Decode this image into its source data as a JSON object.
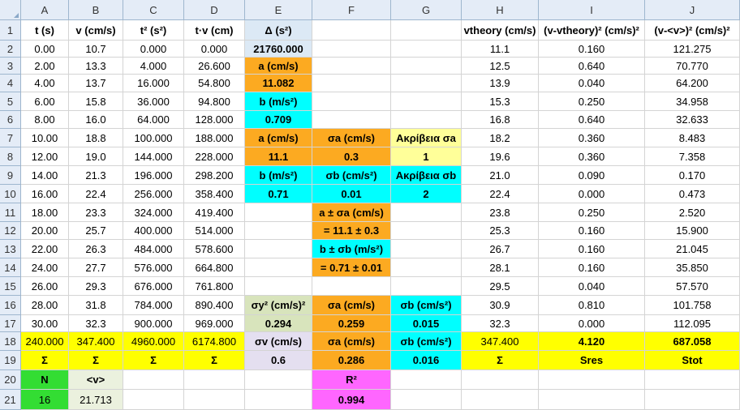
{
  "columns": [
    "A",
    "B",
    "C",
    "D",
    "E",
    "F",
    "G",
    "H",
    "I",
    "J"
  ],
  "rows": [
    "1",
    "2",
    "3",
    "4",
    "5",
    "6",
    "7",
    "8",
    "9",
    "10",
    "11",
    "12",
    "13",
    "14",
    "15",
    "16",
    "17",
    "18",
    "19",
    "20",
    "21"
  ],
  "colors": {
    "orange": "#fcaa21",
    "cyan": "#00ffff",
    "lightyellow": "#ffff99",
    "yellow": "#ffff00",
    "lightblue": "#dce9f5",
    "lightgreen": "#d8e4bc",
    "green": "#33dd33",
    "lavender": "#e4dff0",
    "magenta": "#ff66ff",
    "greenbg": "#ebf1de"
  },
  "cells": [
    {
      "r": 1,
      "c": "A",
      "t": "t (s)",
      "b": true
    },
    {
      "r": 1,
      "c": "B",
      "t": "v (cm/s)",
      "b": true
    },
    {
      "r": 1,
      "c": "C",
      "t": "t² (s²)",
      "b": true
    },
    {
      "r": 1,
      "c": "D",
      "t": "t·v (cm)",
      "b": true
    },
    {
      "r": 1,
      "c": "E",
      "t": "Δ (s²)",
      "b": true,
      "bg": "lightblue"
    },
    {
      "r": 1,
      "c": "H",
      "t": "vtheory (cm/s)",
      "b": true
    },
    {
      "r": 1,
      "c": "I",
      "t": "(v-vtheory)² (cm/s)²",
      "b": true
    },
    {
      "r": 1,
      "c": "J",
      "t": "(v-<v>)² (cm/s)²",
      "b": true
    },
    {
      "r": 2,
      "c": "A",
      "t": "0.00"
    },
    {
      "r": 2,
      "c": "B",
      "t": "10.7"
    },
    {
      "r": 2,
      "c": "C",
      "t": "0.000"
    },
    {
      "r": 2,
      "c": "D",
      "t": "0.000"
    },
    {
      "r": 2,
      "c": "E",
      "t": "21760.000",
      "b": true,
      "bg": "lightblue"
    },
    {
      "r": 2,
      "c": "H",
      "t": "11.1"
    },
    {
      "r": 2,
      "c": "I",
      "t": "0.160"
    },
    {
      "r": 2,
      "c": "J",
      "t": "121.275"
    },
    {
      "r": 3,
      "c": "A",
      "t": "2.00"
    },
    {
      "r": 3,
      "c": "B",
      "t": "13.3"
    },
    {
      "r": 3,
      "c": "C",
      "t": "4.000"
    },
    {
      "r": 3,
      "c": "D",
      "t": "26.600"
    },
    {
      "r": 3,
      "c": "E",
      "t": "a (cm/s)",
      "b": true,
      "bg": "orange"
    },
    {
      "r": 3,
      "c": "H",
      "t": "12.5"
    },
    {
      "r": 3,
      "c": "I",
      "t": "0.640"
    },
    {
      "r": 3,
      "c": "J",
      "t": "70.770"
    },
    {
      "r": 4,
      "c": "A",
      "t": "4.00"
    },
    {
      "r": 4,
      "c": "B",
      "t": "13.7"
    },
    {
      "r": 4,
      "c": "C",
      "t": "16.000"
    },
    {
      "r": 4,
      "c": "D",
      "t": "54.800"
    },
    {
      "r": 4,
      "c": "E",
      "t": "11.082",
      "b": true,
      "bg": "orange"
    },
    {
      "r": 4,
      "c": "H",
      "t": "13.9"
    },
    {
      "r": 4,
      "c": "I",
      "t": "0.040"
    },
    {
      "r": 4,
      "c": "J",
      "t": "64.200"
    },
    {
      "r": 5,
      "c": "A",
      "t": "6.00"
    },
    {
      "r": 5,
      "c": "B",
      "t": "15.8"
    },
    {
      "r": 5,
      "c": "C",
      "t": "36.000"
    },
    {
      "r": 5,
      "c": "D",
      "t": "94.800"
    },
    {
      "r": 5,
      "c": "E",
      "t": "b (m/s²)",
      "b": true,
      "bg": "cyan"
    },
    {
      "r": 5,
      "c": "H",
      "t": "15.3"
    },
    {
      "r": 5,
      "c": "I",
      "t": "0.250"
    },
    {
      "r": 5,
      "c": "J",
      "t": "34.958"
    },
    {
      "r": 6,
      "c": "A",
      "t": "8.00"
    },
    {
      "r": 6,
      "c": "B",
      "t": "16.0"
    },
    {
      "r": 6,
      "c": "C",
      "t": "64.000"
    },
    {
      "r": 6,
      "c": "D",
      "t": "128.000"
    },
    {
      "r": 6,
      "c": "E",
      "t": "0.709",
      "b": true,
      "bg": "cyan"
    },
    {
      "r": 6,
      "c": "H",
      "t": "16.8"
    },
    {
      "r": 6,
      "c": "I",
      "t": "0.640"
    },
    {
      "r": 6,
      "c": "J",
      "t": "32.633"
    },
    {
      "r": 7,
      "c": "A",
      "t": "10.00"
    },
    {
      "r": 7,
      "c": "B",
      "t": "18.8"
    },
    {
      "r": 7,
      "c": "C",
      "t": "100.000"
    },
    {
      "r": 7,
      "c": "D",
      "t": "188.000"
    },
    {
      "r": 7,
      "c": "E",
      "t": "a (cm/s)",
      "b": true,
      "bg": "orange"
    },
    {
      "r": 7,
      "c": "F",
      "t": "σa (cm/s)",
      "b": true,
      "bg": "orange"
    },
    {
      "r": 7,
      "c": "G",
      "t": "Ακρίβεια σa",
      "b": true,
      "bg": "lightyellow"
    },
    {
      "r": 7,
      "c": "H",
      "t": "18.2"
    },
    {
      "r": 7,
      "c": "I",
      "t": "0.360"
    },
    {
      "r": 7,
      "c": "J",
      "t": "8.483"
    },
    {
      "r": 8,
      "c": "A",
      "t": "12.00"
    },
    {
      "r": 8,
      "c": "B",
      "t": "19.0"
    },
    {
      "r": 8,
      "c": "C",
      "t": "144.000"
    },
    {
      "r": 8,
      "c": "D",
      "t": "228.000"
    },
    {
      "r": 8,
      "c": "E",
      "t": "11.1",
      "b": true,
      "bg": "orange"
    },
    {
      "r": 8,
      "c": "F",
      "t": "0.3",
      "b": true,
      "bg": "orange"
    },
    {
      "r": 8,
      "c": "G",
      "t": "1",
      "b": true,
      "bg": "lightyellow"
    },
    {
      "r": 8,
      "c": "H",
      "t": "19.6"
    },
    {
      "r": 8,
      "c": "I",
      "t": "0.360"
    },
    {
      "r": 8,
      "c": "J",
      "t": "7.358"
    },
    {
      "r": 9,
      "c": "A",
      "t": "14.00"
    },
    {
      "r": 9,
      "c": "B",
      "t": "21.3"
    },
    {
      "r": 9,
      "c": "C",
      "t": "196.000"
    },
    {
      "r": 9,
      "c": "D",
      "t": "298.200"
    },
    {
      "r": 9,
      "c": "E",
      "t": "b (m/s²)",
      "b": true,
      "bg": "cyan"
    },
    {
      "r": 9,
      "c": "F",
      "t": "σb (cm/s²)",
      "b": true,
      "bg": "cyan"
    },
    {
      "r": 9,
      "c": "G",
      "t": "Ακρίβεια σb",
      "b": true,
      "bg": "cyan"
    },
    {
      "r": 9,
      "c": "H",
      "t": "21.0"
    },
    {
      "r": 9,
      "c": "I",
      "t": "0.090"
    },
    {
      "r": 9,
      "c": "J",
      "t": "0.170"
    },
    {
      "r": 10,
      "c": "A",
      "t": "16.00"
    },
    {
      "r": 10,
      "c": "B",
      "t": "22.4"
    },
    {
      "r": 10,
      "c": "C",
      "t": "256.000"
    },
    {
      "r": 10,
      "c": "D",
      "t": "358.400"
    },
    {
      "r": 10,
      "c": "E",
      "t": "0.71",
      "b": true,
      "bg": "cyan"
    },
    {
      "r": 10,
      "c": "F",
      "t": "0.01",
      "b": true,
      "bg": "cyan"
    },
    {
      "r": 10,
      "c": "G",
      "t": "2",
      "b": true,
      "bg": "cyan"
    },
    {
      "r": 10,
      "c": "H",
      "t": "22.4"
    },
    {
      "r": 10,
      "c": "I",
      "t": "0.000"
    },
    {
      "r": 10,
      "c": "J",
      "t": "0.473"
    },
    {
      "r": 11,
      "c": "A",
      "t": "18.00"
    },
    {
      "r": 11,
      "c": "B",
      "t": "23.3"
    },
    {
      "r": 11,
      "c": "C",
      "t": "324.000"
    },
    {
      "r": 11,
      "c": "D",
      "t": "419.400"
    },
    {
      "r": 11,
      "c": "F",
      "t": "a ± σa (cm/s)",
      "b": true,
      "bg": "orange"
    },
    {
      "r": 11,
      "c": "H",
      "t": "23.8"
    },
    {
      "r": 11,
      "c": "I",
      "t": "0.250"
    },
    {
      "r": 11,
      "c": "J",
      "t": "2.520"
    },
    {
      "r": 12,
      "c": "A",
      "t": "20.00"
    },
    {
      "r": 12,
      "c": "B",
      "t": "25.7"
    },
    {
      "r": 12,
      "c": "C",
      "t": "400.000"
    },
    {
      "r": 12,
      "c": "D",
      "t": "514.000"
    },
    {
      "r": 12,
      "c": "F",
      "t": "= 11.1 ± 0.3",
      "b": true,
      "bg": "orange"
    },
    {
      "r": 12,
      "c": "H",
      "t": "25.3"
    },
    {
      "r": 12,
      "c": "I",
      "t": "0.160"
    },
    {
      "r": 12,
      "c": "J",
      "t": "15.900"
    },
    {
      "r": 13,
      "c": "A",
      "t": "22.00"
    },
    {
      "r": 13,
      "c": "B",
      "t": "26.3"
    },
    {
      "r": 13,
      "c": "C",
      "t": "484.000"
    },
    {
      "r": 13,
      "c": "D",
      "t": "578.600"
    },
    {
      "r": 13,
      "c": "F",
      "t": "b ± σb (m/s²)",
      "b": true,
      "bg": "cyan"
    },
    {
      "r": 13,
      "c": "H",
      "t": "26.7"
    },
    {
      "r": 13,
      "c": "I",
      "t": "0.160"
    },
    {
      "r": 13,
      "c": "J",
      "t": "21.045"
    },
    {
      "r": 14,
      "c": "A",
      "t": "24.00"
    },
    {
      "r": 14,
      "c": "B",
      "t": "27.7"
    },
    {
      "r": 14,
      "c": "C",
      "t": "576.000"
    },
    {
      "r": 14,
      "c": "D",
      "t": "664.800"
    },
    {
      "r": 14,
      "c": "F",
      "t": "= 0.71 ± 0.01",
      "b": true,
      "bg": "orange"
    },
    {
      "r": 14,
      "c": "H",
      "t": "28.1"
    },
    {
      "r": 14,
      "c": "I",
      "t": "0.160"
    },
    {
      "r": 14,
      "c": "J",
      "t": "35.850"
    },
    {
      "r": 15,
      "c": "A",
      "t": "26.00"
    },
    {
      "r": 15,
      "c": "B",
      "t": "29.3"
    },
    {
      "r": 15,
      "c": "C",
      "t": "676.000"
    },
    {
      "r": 15,
      "c": "D",
      "t": "761.800"
    },
    {
      "r": 15,
      "c": "H",
      "t": "29.5"
    },
    {
      "r": 15,
      "c": "I",
      "t": "0.040"
    },
    {
      "r": 15,
      "c": "J",
      "t": "57.570"
    },
    {
      "r": 16,
      "c": "A",
      "t": "28.00"
    },
    {
      "r": 16,
      "c": "B",
      "t": "31.8"
    },
    {
      "r": 16,
      "c": "C",
      "t": "784.000"
    },
    {
      "r": 16,
      "c": "D",
      "t": "890.400"
    },
    {
      "r": 16,
      "c": "E",
      "t": "σy² (cm/s)²",
      "b": true,
      "bg": "lightgreen"
    },
    {
      "r": 16,
      "c": "F",
      "t": "σa (cm/s)",
      "b": true,
      "bg": "orange"
    },
    {
      "r": 16,
      "c": "G",
      "t": "σb (cm/s²)",
      "b": true,
      "bg": "cyan"
    },
    {
      "r": 16,
      "c": "H",
      "t": "30.9"
    },
    {
      "r": 16,
      "c": "I",
      "t": "0.810"
    },
    {
      "r": 16,
      "c": "J",
      "t": "101.758"
    },
    {
      "r": 17,
      "c": "A",
      "t": "30.00"
    },
    {
      "r": 17,
      "c": "B",
      "t": "32.3"
    },
    {
      "r": 17,
      "c": "C",
      "t": "900.000"
    },
    {
      "r": 17,
      "c": "D",
      "t": "969.000"
    },
    {
      "r": 17,
      "c": "E",
      "t": "0.294",
      "b": true,
      "bg": "lightgreen"
    },
    {
      "r": 17,
      "c": "F",
      "t": "0.259",
      "b": true,
      "bg": "orange"
    },
    {
      "r": 17,
      "c": "G",
      "t": "0.015",
      "b": true,
      "bg": "cyan"
    },
    {
      "r": 17,
      "c": "H",
      "t": "32.3"
    },
    {
      "r": 17,
      "c": "I",
      "t": "0.000"
    },
    {
      "r": 17,
      "c": "J",
      "t": "112.095"
    },
    {
      "r": 18,
      "c": "A",
      "t": "240.000",
      "bg": "yellow"
    },
    {
      "r": 18,
      "c": "B",
      "t": "347.400",
      "bg": "yellow"
    },
    {
      "r": 18,
      "c": "C",
      "t": "4960.000",
      "bg": "yellow"
    },
    {
      "r": 18,
      "c": "D",
      "t": "6174.800",
      "bg": "yellow"
    },
    {
      "r": 18,
      "c": "E",
      "t": "σv (cm/s)",
      "b": true,
      "bg": "lavender"
    },
    {
      "r": 18,
      "c": "F",
      "t": "σa (cm/s)",
      "b": true,
      "bg": "orange"
    },
    {
      "r": 18,
      "c": "G",
      "t": "σb (cm/s²)",
      "b": true,
      "bg": "cyan"
    },
    {
      "r": 18,
      "c": "H",
      "t": "347.400",
      "bg": "yellow"
    },
    {
      "r": 18,
      "c": "I",
      "t": "4.120",
      "b": true,
      "bg": "yellow"
    },
    {
      "r": 18,
      "c": "J",
      "t": "687.058",
      "b": true,
      "bg": "yellow"
    },
    {
      "r": 19,
      "c": "A",
      "t": "Σ",
      "b": true,
      "bg": "yellow"
    },
    {
      "r": 19,
      "c": "B",
      "t": "Σ",
      "b": true,
      "bg": "yellow"
    },
    {
      "r": 19,
      "c": "C",
      "t": "Σ",
      "b": true,
      "bg": "yellow"
    },
    {
      "r": 19,
      "c": "D",
      "t": "Σ",
      "b": true,
      "bg": "yellow"
    },
    {
      "r": 19,
      "c": "E",
      "t": "0.6",
      "b": true,
      "bg": "lavender"
    },
    {
      "r": 19,
      "c": "F",
      "t": "0.286",
      "b": true,
      "bg": "orange"
    },
    {
      "r": 19,
      "c": "G",
      "t": "0.016",
      "b": true,
      "bg": "cyan"
    },
    {
      "r": 19,
      "c": "H",
      "t": "Σ",
      "b": true,
      "bg": "yellow"
    },
    {
      "r": 19,
      "c": "I",
      "t": "Sres",
      "b": true,
      "bg": "yellow"
    },
    {
      "r": 19,
      "c": "J",
      "t": "Stot",
      "b": true,
      "bg": "yellow"
    },
    {
      "r": 20,
      "c": "A",
      "t": "N",
      "b": true,
      "bg": "green"
    },
    {
      "r": 20,
      "c": "B",
      "t": "<v>",
      "b": true,
      "bg": "greenbg"
    },
    {
      "r": 20,
      "c": "F",
      "t": "R²",
      "b": true,
      "bg": "magenta"
    },
    {
      "r": 21,
      "c": "A",
      "t": "16",
      "bg": "green"
    },
    {
      "r": 21,
      "c": "B",
      "t": "21.713",
      "bg": "greenbg"
    },
    {
      "r": 21,
      "c": "F",
      "t": "0.994",
      "b": true,
      "bg": "magenta"
    }
  ]
}
